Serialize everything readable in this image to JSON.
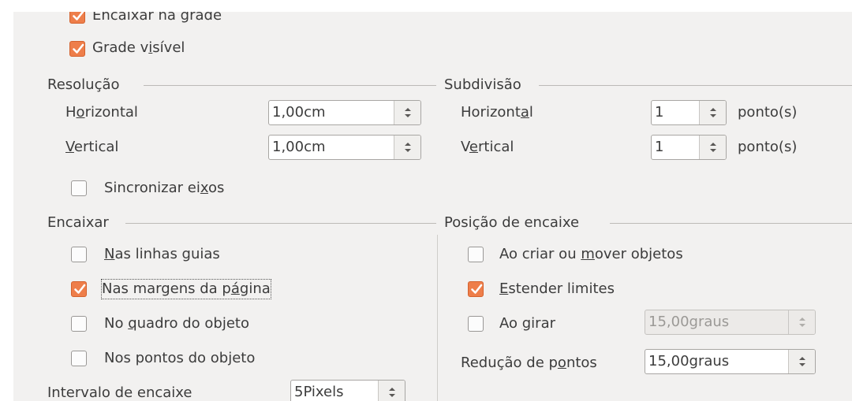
{
  "grid": {
    "snap_to_grid": {
      "label": "Encaixar na grade",
      "checked": true
    },
    "visible_grid": {
      "pre": "Grade v",
      "ul": "i",
      "post": "sível",
      "checked": true
    }
  },
  "resolution": {
    "title": "Resolução",
    "horizontal": {
      "pre": "H",
      "ul": "o",
      "post": "rizontal",
      "value": "1,00cm"
    },
    "vertical": {
      "pre": "",
      "ul": "V",
      "post": "ertical",
      "value": "1,00cm"
    },
    "sync_axes": {
      "pre": "Sincronizar ei",
      "ul": "x",
      "post": "os",
      "checked": false
    }
  },
  "subdivision": {
    "title": "Subdivisão",
    "horizontal": {
      "pre": "Horizont",
      "ul": "a",
      "post": "l",
      "value": "1",
      "unit": "ponto(s)"
    },
    "vertical": {
      "pre": "V",
      "ul": "e",
      "post": "rtical",
      "value": "1",
      "unit": "ponto(s)"
    }
  },
  "snap": {
    "title": "Encaixar",
    "guides": {
      "pre": "",
      "ul": "N",
      "post": "as linhas guias",
      "checked": false
    },
    "page_margins": {
      "pre": "Nas margens da p",
      "ul": "á",
      "post": "gina",
      "checked": true
    },
    "object_frame": {
      "pre": "No ",
      "ul": "q",
      "post": "uadro do objeto",
      "checked": false
    },
    "object_points": {
      "pre": "Nos pontos do ob",
      "ul": "j",
      "post": "eto",
      "checked": false
    },
    "range": {
      "label": "Intervalo de encaixe",
      "value": "5Pixels"
    }
  },
  "snap_position": {
    "title": "Posição de encaixe",
    "create_move": {
      "pre": "Ao criar ou ",
      "ul": "m",
      "post": "over objetos",
      "checked": false
    },
    "extend_edges": {
      "pre": "",
      "ul": "E",
      "post": "stender limites",
      "checked": true
    },
    "rotate": {
      "pre": "Ao ",
      "ul": "g",
      "post": "irar",
      "checked": false,
      "value": "15,00graus"
    },
    "point_reduction": {
      "pre": "Redução de p",
      "ul": "o",
      "post": "ntos",
      "value": "15,00graus"
    }
  }
}
